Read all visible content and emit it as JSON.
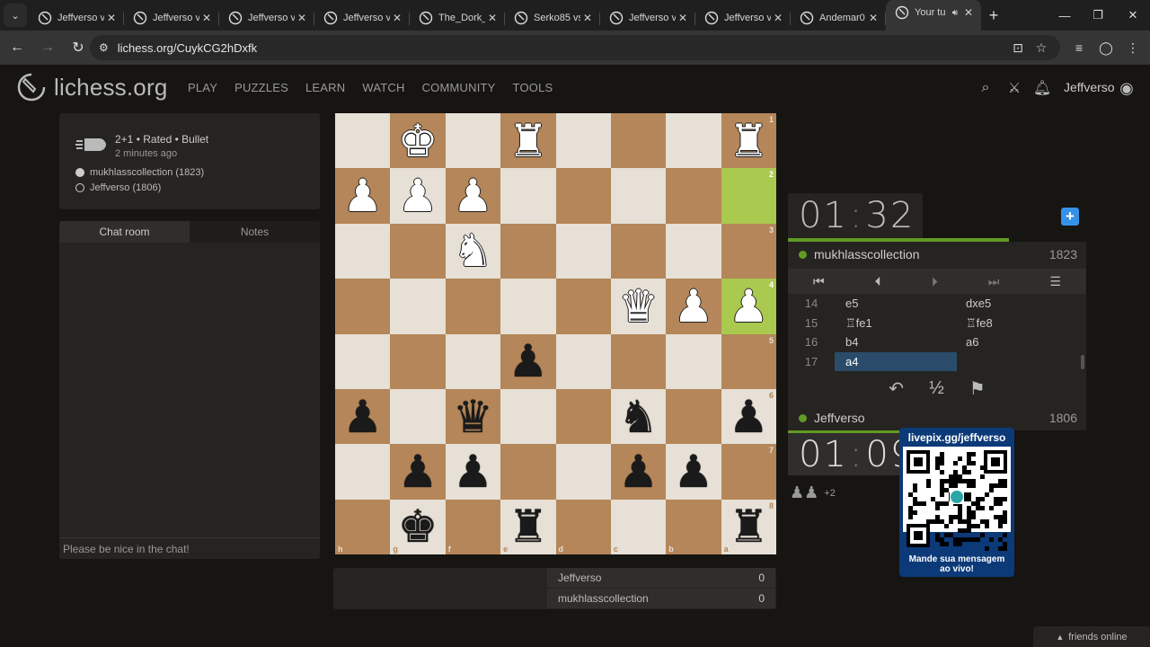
{
  "browser": {
    "tabs": [
      {
        "label": "Jeffverso v"
      },
      {
        "label": "Jeffverso v"
      },
      {
        "label": "Jeffverso v"
      },
      {
        "label": "Jeffverso v"
      },
      {
        "label": "The_Dork_"
      },
      {
        "label": "Serko85 vs"
      },
      {
        "label": "Jeffverso v"
      },
      {
        "label": "Jeffverso v"
      },
      {
        "label": "Andemar0"
      },
      {
        "label": "Your tu"
      }
    ],
    "url": "lichess.org/CuykCG2hDxfk"
  },
  "site": {
    "logo_text": "lichess.org",
    "nav": [
      "PLAY",
      "PUZZLES",
      "LEARN",
      "WATCH",
      "COMMUNITY",
      "TOOLS"
    ],
    "username": "Jeffverso"
  },
  "game": {
    "title": "2+1 • Rated • Bullet",
    "time_ago": "2 minutes ago",
    "players": [
      "mukhlasscollection (1823)",
      "Jeffverso (1806)"
    ]
  },
  "chat": {
    "tabs": [
      "Chat room",
      "Notes"
    ],
    "placeholder": "Please be nice in the chat!"
  },
  "board": {
    "ranks": [
      "1",
      "2",
      "3",
      "4",
      "5",
      "6",
      "7",
      "8"
    ],
    "files": [
      "h",
      "g",
      "f",
      "e",
      "d",
      "c",
      "b",
      "a"
    ],
    "pieces": [
      {
        "r": 0,
        "c": 1,
        "p": "K",
        "color": "w"
      },
      {
        "r": 0,
        "c": 3,
        "p": "R",
        "color": "w"
      },
      {
        "r": 0,
        "c": 7,
        "p": "R",
        "color": "w"
      },
      {
        "r": 1,
        "c": 0,
        "p": "P",
        "color": "w"
      },
      {
        "r": 1,
        "c": 1,
        "p": "P",
        "color": "w"
      },
      {
        "r": 1,
        "c": 2,
        "p": "P",
        "color": "w"
      },
      {
        "r": 2,
        "c": 2,
        "p": "N",
        "color": "w"
      },
      {
        "r": 3,
        "c": 5,
        "p": "Q",
        "color": "w"
      },
      {
        "r": 3,
        "c": 6,
        "p": "P",
        "color": "w"
      },
      {
        "r": 3,
        "c": 7,
        "p": "P",
        "color": "w"
      },
      {
        "r": 4,
        "c": 3,
        "p": "P",
        "color": "b"
      },
      {
        "r": 5,
        "c": 0,
        "p": "P",
        "color": "b"
      },
      {
        "r": 5,
        "c": 2,
        "p": "Q",
        "color": "b"
      },
      {
        "r": 5,
        "c": 5,
        "p": "N",
        "color": "b"
      },
      {
        "r": 5,
        "c": 7,
        "p": "P",
        "color": "b"
      },
      {
        "r": 6,
        "c": 1,
        "p": "P",
        "color": "b"
      },
      {
        "r": 6,
        "c": 2,
        "p": "P",
        "color": "b"
      },
      {
        "r": 6,
        "c": 5,
        "p": "P",
        "color": "b"
      },
      {
        "r": 6,
        "c": 6,
        "p": "P",
        "color": "b"
      },
      {
        "r": 7,
        "c": 1,
        "p": "K",
        "color": "b"
      },
      {
        "r": 7,
        "c": 3,
        "p": "R",
        "color": "b"
      },
      {
        "r": 7,
        "c": 7,
        "p": "R",
        "color": "b"
      }
    ],
    "highlights": [
      {
        "r": 1,
        "c": 7
      },
      {
        "r": 3,
        "c": 7
      }
    ]
  },
  "clock": {
    "top": {
      "min": "01",
      "sec": "32"
    },
    "bottom": {
      "min": "01",
      "sec": "09"
    },
    "top_progress": 0.74
  },
  "opponent": {
    "name": "mukhlasscollection",
    "rating": "1823"
  },
  "me": {
    "name": "Jeffverso",
    "rating": "1806"
  },
  "moves": [
    {
      "no": "14",
      "w": "e5",
      "b": "dxe5"
    },
    {
      "no": "15",
      "w": "♖fe1",
      "b": "♖fe8"
    },
    {
      "no": "16",
      "w": "b4",
      "b": "a6"
    },
    {
      "no": "17",
      "w": "a4",
      "b": ""
    }
  ],
  "spectators": "+2",
  "overlay": {
    "url": "livepix.gg/jeffverso",
    "line1": "Mande sua mensagem",
    "line2": "ao vivo!"
  },
  "crosstable": [
    {
      "name": "Jeffverso",
      "score": "0"
    },
    {
      "name": "mukhlasscollection",
      "score": "0"
    }
  ],
  "footer": {
    "friends": "friends online"
  }
}
